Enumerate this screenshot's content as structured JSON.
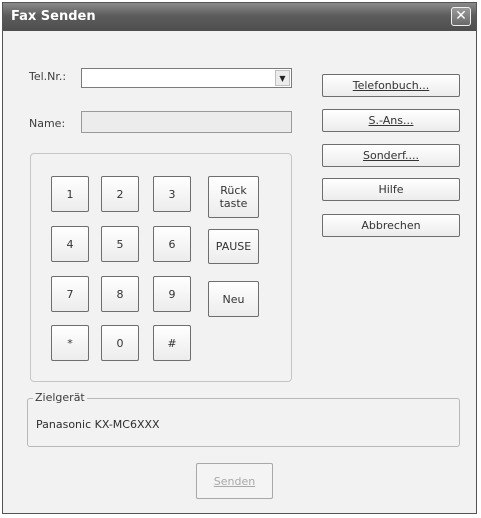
{
  "window": {
    "title": "Fax Senden",
    "close_glyph": "✕"
  },
  "form": {
    "tel_label": "Tel.Nr.:",
    "tel_value": "",
    "name_label": "Name:",
    "name_value": ""
  },
  "keypad": {
    "keys": [
      "1",
      "2",
      "3",
      "4",
      "5",
      "6",
      "7",
      "8",
      "9",
      "*",
      "0",
      "#"
    ],
    "backspace_line1": "Rück",
    "backspace_line2": "taste",
    "pause": "PAUSE",
    "new": "Neu"
  },
  "side_buttons": {
    "phonebook": "Telefonbuch...",
    "broadcast": "S.-Ans...",
    "special": "Sonderf....",
    "help": "Hilfe",
    "cancel": "Abbrechen"
  },
  "target_device": {
    "legend": "Zielgerät",
    "value": "Panasonic KX-MC6XXX"
  },
  "send_button": "Senden"
}
